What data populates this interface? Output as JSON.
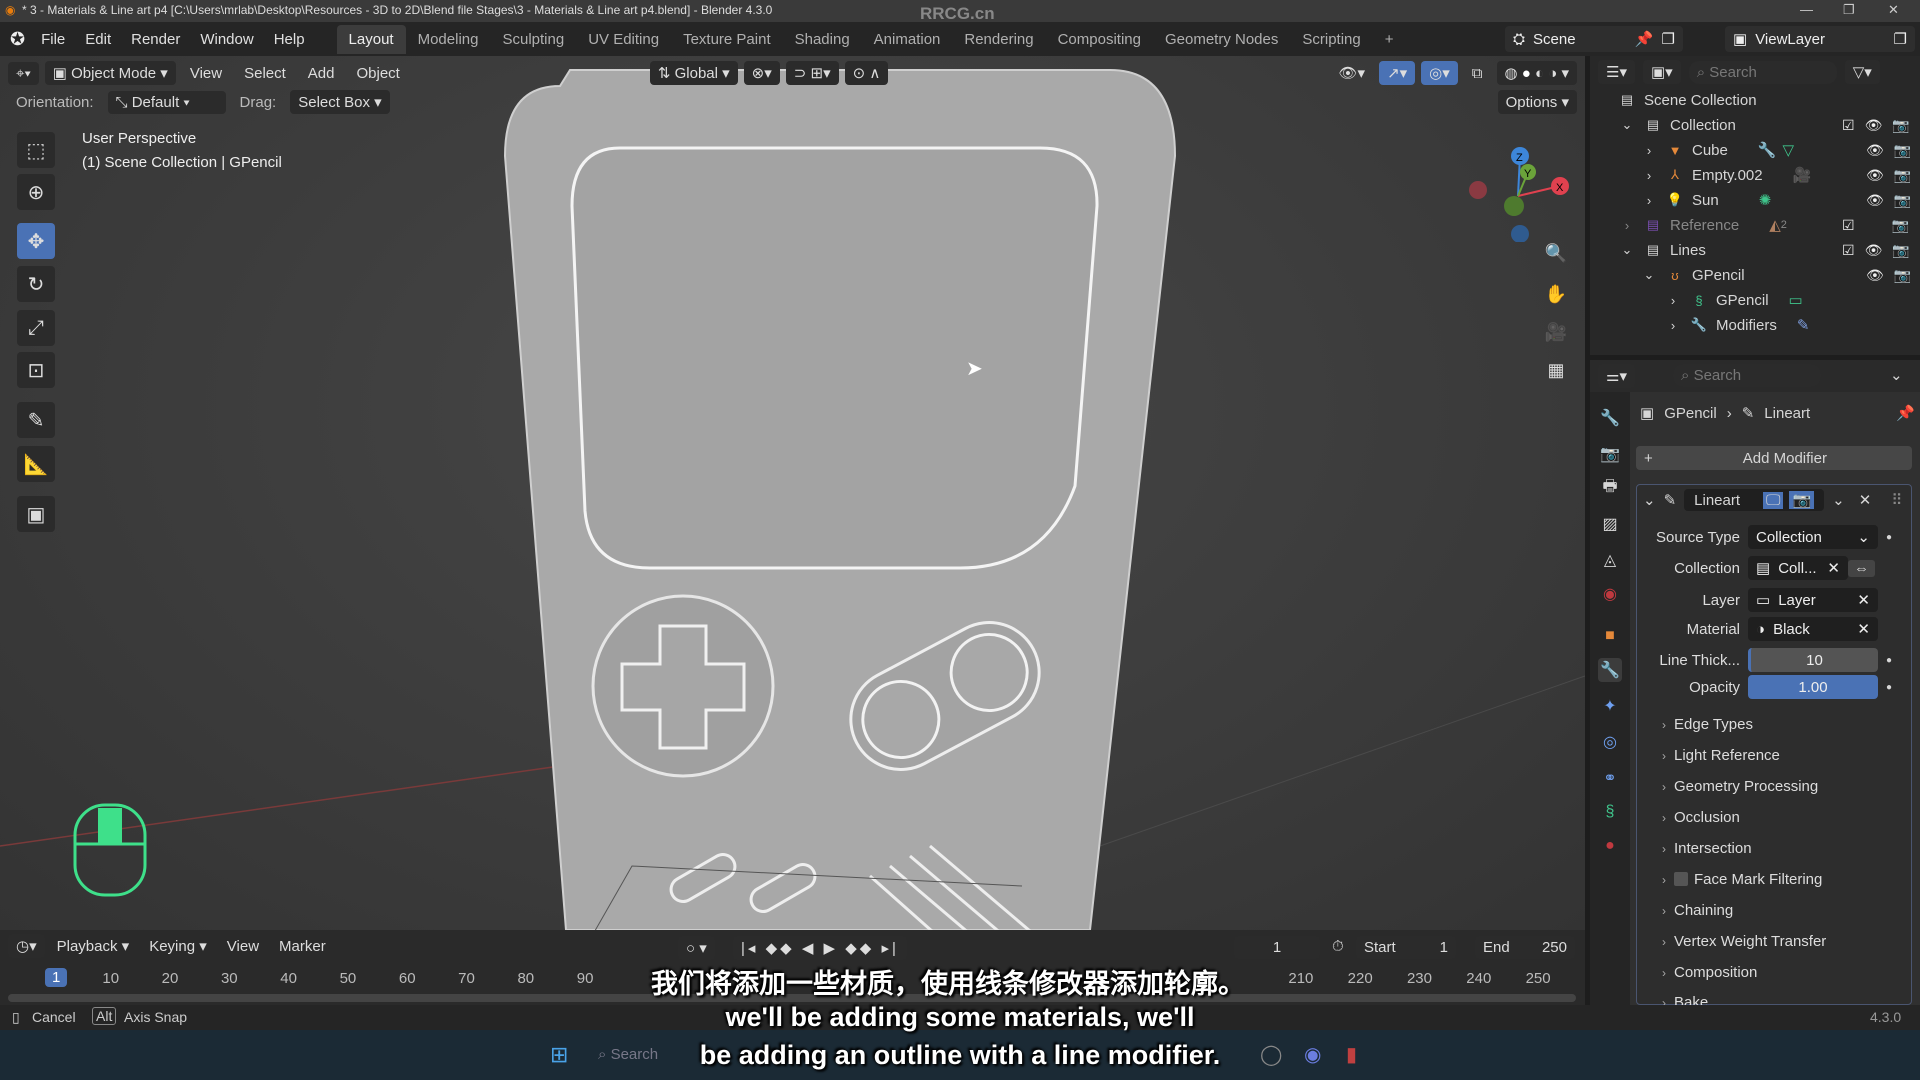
{
  "window": {
    "title": "* 3 - Materials & Line art p4 [C:\\Users\\mrlab\\Desktop\\Resources - 3D to 2D\\Blend file Stages\\3 - Materials & Line art p4.blend] - Blender 4.3.0",
    "watermark": "RRCG.cn"
  },
  "menu": [
    "File",
    "Edit",
    "Render",
    "Window",
    "Help"
  ],
  "workspaces": [
    "Layout",
    "Modeling",
    "Sculpting",
    "UV Editing",
    "Texture Paint",
    "Shading",
    "Animation",
    "Rendering",
    "Compositing",
    "Geometry Nodes",
    "Scripting"
  ],
  "active_workspace": "Layout",
  "scene": {
    "scene": "Scene",
    "view_layer": "ViewLayer"
  },
  "viewport": {
    "mode": "Object Mode",
    "menus": [
      "View",
      "Select",
      "Add",
      "Object"
    ],
    "transform_orientation": "Global",
    "orientation_label": "Orientation:",
    "orientation_value": "Default",
    "drag_label": "Drag:",
    "drag_value": "Select Box",
    "options": "Options",
    "overlay_title": "User Perspective",
    "overlay_sub": "(1) Scene Collection | GPencil",
    "gizmo": {
      "x": "X",
      "y": "Y",
      "z": "Z"
    },
    "colors": {
      "x": "#e0414f",
      "y": "#6ba33a",
      "z": "#3d86d9"
    }
  },
  "outliner": {
    "search_placeholder": "Search",
    "items": [
      {
        "label": "Scene Collection"
      },
      {
        "label": "Collection"
      },
      {
        "label": "Cube"
      },
      {
        "label": "Empty.002"
      },
      {
        "label": "Sun"
      },
      {
        "label": "Reference",
        "badge": "2"
      },
      {
        "label": "Lines"
      },
      {
        "label": "GPencil"
      },
      {
        "label": "GPencil"
      },
      {
        "label": "Modifiers"
      }
    ]
  },
  "properties": {
    "search_placeholder": "Search",
    "breadcrumb": [
      "GPencil",
      "Lineart"
    ],
    "add_modifier": "Add Modifier",
    "modifier_name": "Lineart",
    "fields": {
      "source_type": {
        "label": "Source Type",
        "value": "Collection"
      },
      "collection": {
        "label": "Collection",
        "value": "Coll..."
      },
      "layer": {
        "label": "Layer",
        "value": "Layer"
      },
      "material": {
        "label": "Material",
        "value": "Black"
      },
      "line_thickness": {
        "label": "Line Thick...",
        "value": "10"
      },
      "opacity": {
        "label": "Opacity",
        "value": "1.00"
      }
    },
    "subpanels": [
      "Edge Types",
      "Light Reference",
      "Geometry Processing",
      "Occlusion",
      "Intersection",
      "Face Mark Filtering",
      "Chaining",
      "Vertex Weight Transfer",
      "Composition",
      "Bake"
    ]
  },
  "timeline": {
    "menus": [
      "Playback",
      "Keying",
      "View",
      "Marker"
    ],
    "current_frame": "1",
    "start_label": "Start",
    "start": "1",
    "end_label": "End",
    "end": "250",
    "ticks": [
      "10",
      "20",
      "30",
      "40",
      "50",
      "60",
      "70",
      "80",
      "90",
      "210",
      "220",
      "230",
      "240",
      "250"
    ],
    "current_marker": "1"
  },
  "status": {
    "cancel": "Cancel",
    "alt_key": "Alt",
    "axis_snap": "Axis Snap",
    "version": "4.3.0"
  },
  "taskbar": {
    "search": "Search"
  },
  "subtitles": {
    "zh": "我们将添加一些材质，使用线条修改器添加轮廓。",
    "en1": "we'll be adding some materials, we'll",
    "en2": "be adding an outline with a line modifier."
  },
  "accent": "#4a72b5"
}
